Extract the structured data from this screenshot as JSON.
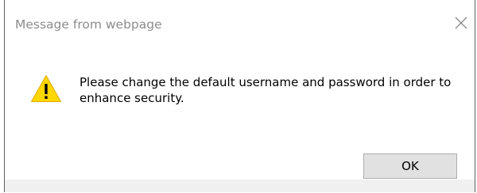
{
  "dialog": {
    "title": "Message from webpage",
    "close_icon": "close-icon",
    "warning_icon": "warning-icon",
    "message": "Please change the default username and password in order to enhance security.",
    "ok_label": "OK"
  },
  "colors": {
    "title_text": "#8c8c8c",
    "warning_yellow": "#ffd700",
    "button_bg": "#e1e1e1",
    "button_border": "#adadad",
    "footer_bg": "#f0f0f0"
  }
}
